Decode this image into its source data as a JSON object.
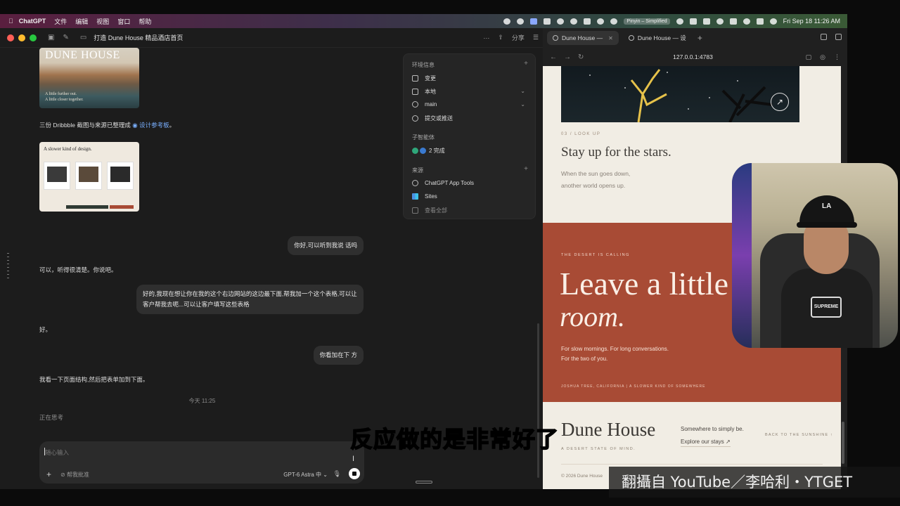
{
  "menubar": {
    "app_name": "ChatGPT",
    "menus": [
      "文件",
      "编辑",
      "视图",
      "窗口",
      "帮助"
    ],
    "pinyin_badge": "Pinyin – Simplified",
    "datetime": "Fri Sep 18  11:26 AM"
  },
  "window": {
    "title": "打造 Dune House 精品酒店首页",
    "share_label": "分享"
  },
  "conversation": {
    "thumb1_title": "DUNE HOUSE",
    "thumb1_caption": [
      "A little further out.",
      "A little closer together."
    ],
    "design_msg_prefix": "三份 Dribbble 截图与来源已整理成",
    "design_msg_link": "设计参考板",
    "design_msg_suffix": "。",
    "thumb2_title": "A slower kind of design.",
    "user_msg_1": "你好,可以听到我说 话吗",
    "ai_msg_1": "可以，听得很清楚。你说吧。",
    "user_msg_2": "好的,我现在想让你在我的这个右边网站的这边最下面,帮我加一个这个表格,可以让客户帮我去呃...可以让客户填写这些表格",
    "ai_msg_2": "好。",
    "user_msg_3": "你看加在下 方",
    "ai_msg_3": "我看一下页面结构,然后把表单加到下面。",
    "timestamp": "今天 11:25",
    "thinking": "正在思考"
  },
  "composer": {
    "placeholder": "随心输入",
    "approve_label": "帮我批准",
    "model_label": "GPT-6 Astra 中"
  },
  "env_panel": {
    "section_env": "环境信息",
    "item_changes": "变更",
    "item_local": "本地",
    "item_branch": "main",
    "item_commit": "提交或推送",
    "section_subagents": "子智能体",
    "subagents_status": "2 完成",
    "section_sources": "来源",
    "source_1": "ChatGPT App Tools",
    "source_2": "Sites",
    "view_all": "查看全部"
  },
  "browser": {
    "tab1": "Dune House —",
    "tab2": "Dune House — 设",
    "url": "127.0.0.1:4783"
  },
  "website": {
    "section_tag": "03 / LOOK UP",
    "stay_title": "Stay up for the stars.",
    "stay_line1": "When the sun goes down,",
    "stay_line2": "another world opens up.",
    "calling_tag": "THE DESERT IS CALLING",
    "big_line1": "Leave a little",
    "big_line2": "room.",
    "desc_line1": "For slow mornings. For long conversations.",
    "desc_line2": "For the two of you.",
    "calling_footer": "JOSHUA TREE, CALIFORNIA   |   A SLOWER KIND OF SOMEWHERE",
    "footer_brand": "Dune House",
    "footer_tag": "A DESERT STATE OF MIND.",
    "footer_somewhere": "Somewhere to simply be.",
    "footer_explore": "Explore our stays ↗",
    "footer_back": "BACK TO THE SUNSHINE ↑",
    "footer_copy": "© 2026 Dune House"
  },
  "webcam": {
    "cap_logo": "LA",
    "shirt_logo": "SUPREME"
  },
  "overlay": {
    "subtitle": "反应做的是非常好了",
    "watermark": "翻攝自 YouTube／李哈利・YTGET"
  }
}
